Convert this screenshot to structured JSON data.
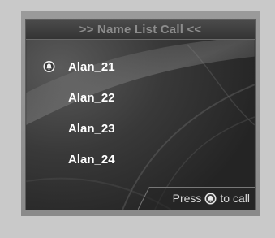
{
  "screen": {
    "title": ">> Name List Call <<",
    "items": [
      {
        "label": "Alan_21",
        "selected": true
      },
      {
        "label": "Alan_22",
        "selected": false
      },
      {
        "label": "Alan_23",
        "selected": false
      },
      {
        "label": "Alan_24",
        "selected": false
      }
    ],
    "footer": {
      "prefix": "Press",
      "suffix": "to call",
      "icon": "call-bell-icon"
    }
  },
  "colors": {
    "page_background": "#c9c9c9",
    "bezel": "#8f8f8f",
    "screen_background": "#2b2b2b",
    "title_text": "#8c8c8c",
    "item_text": "#ffffff",
    "footer_text": "#d8d8d8"
  }
}
